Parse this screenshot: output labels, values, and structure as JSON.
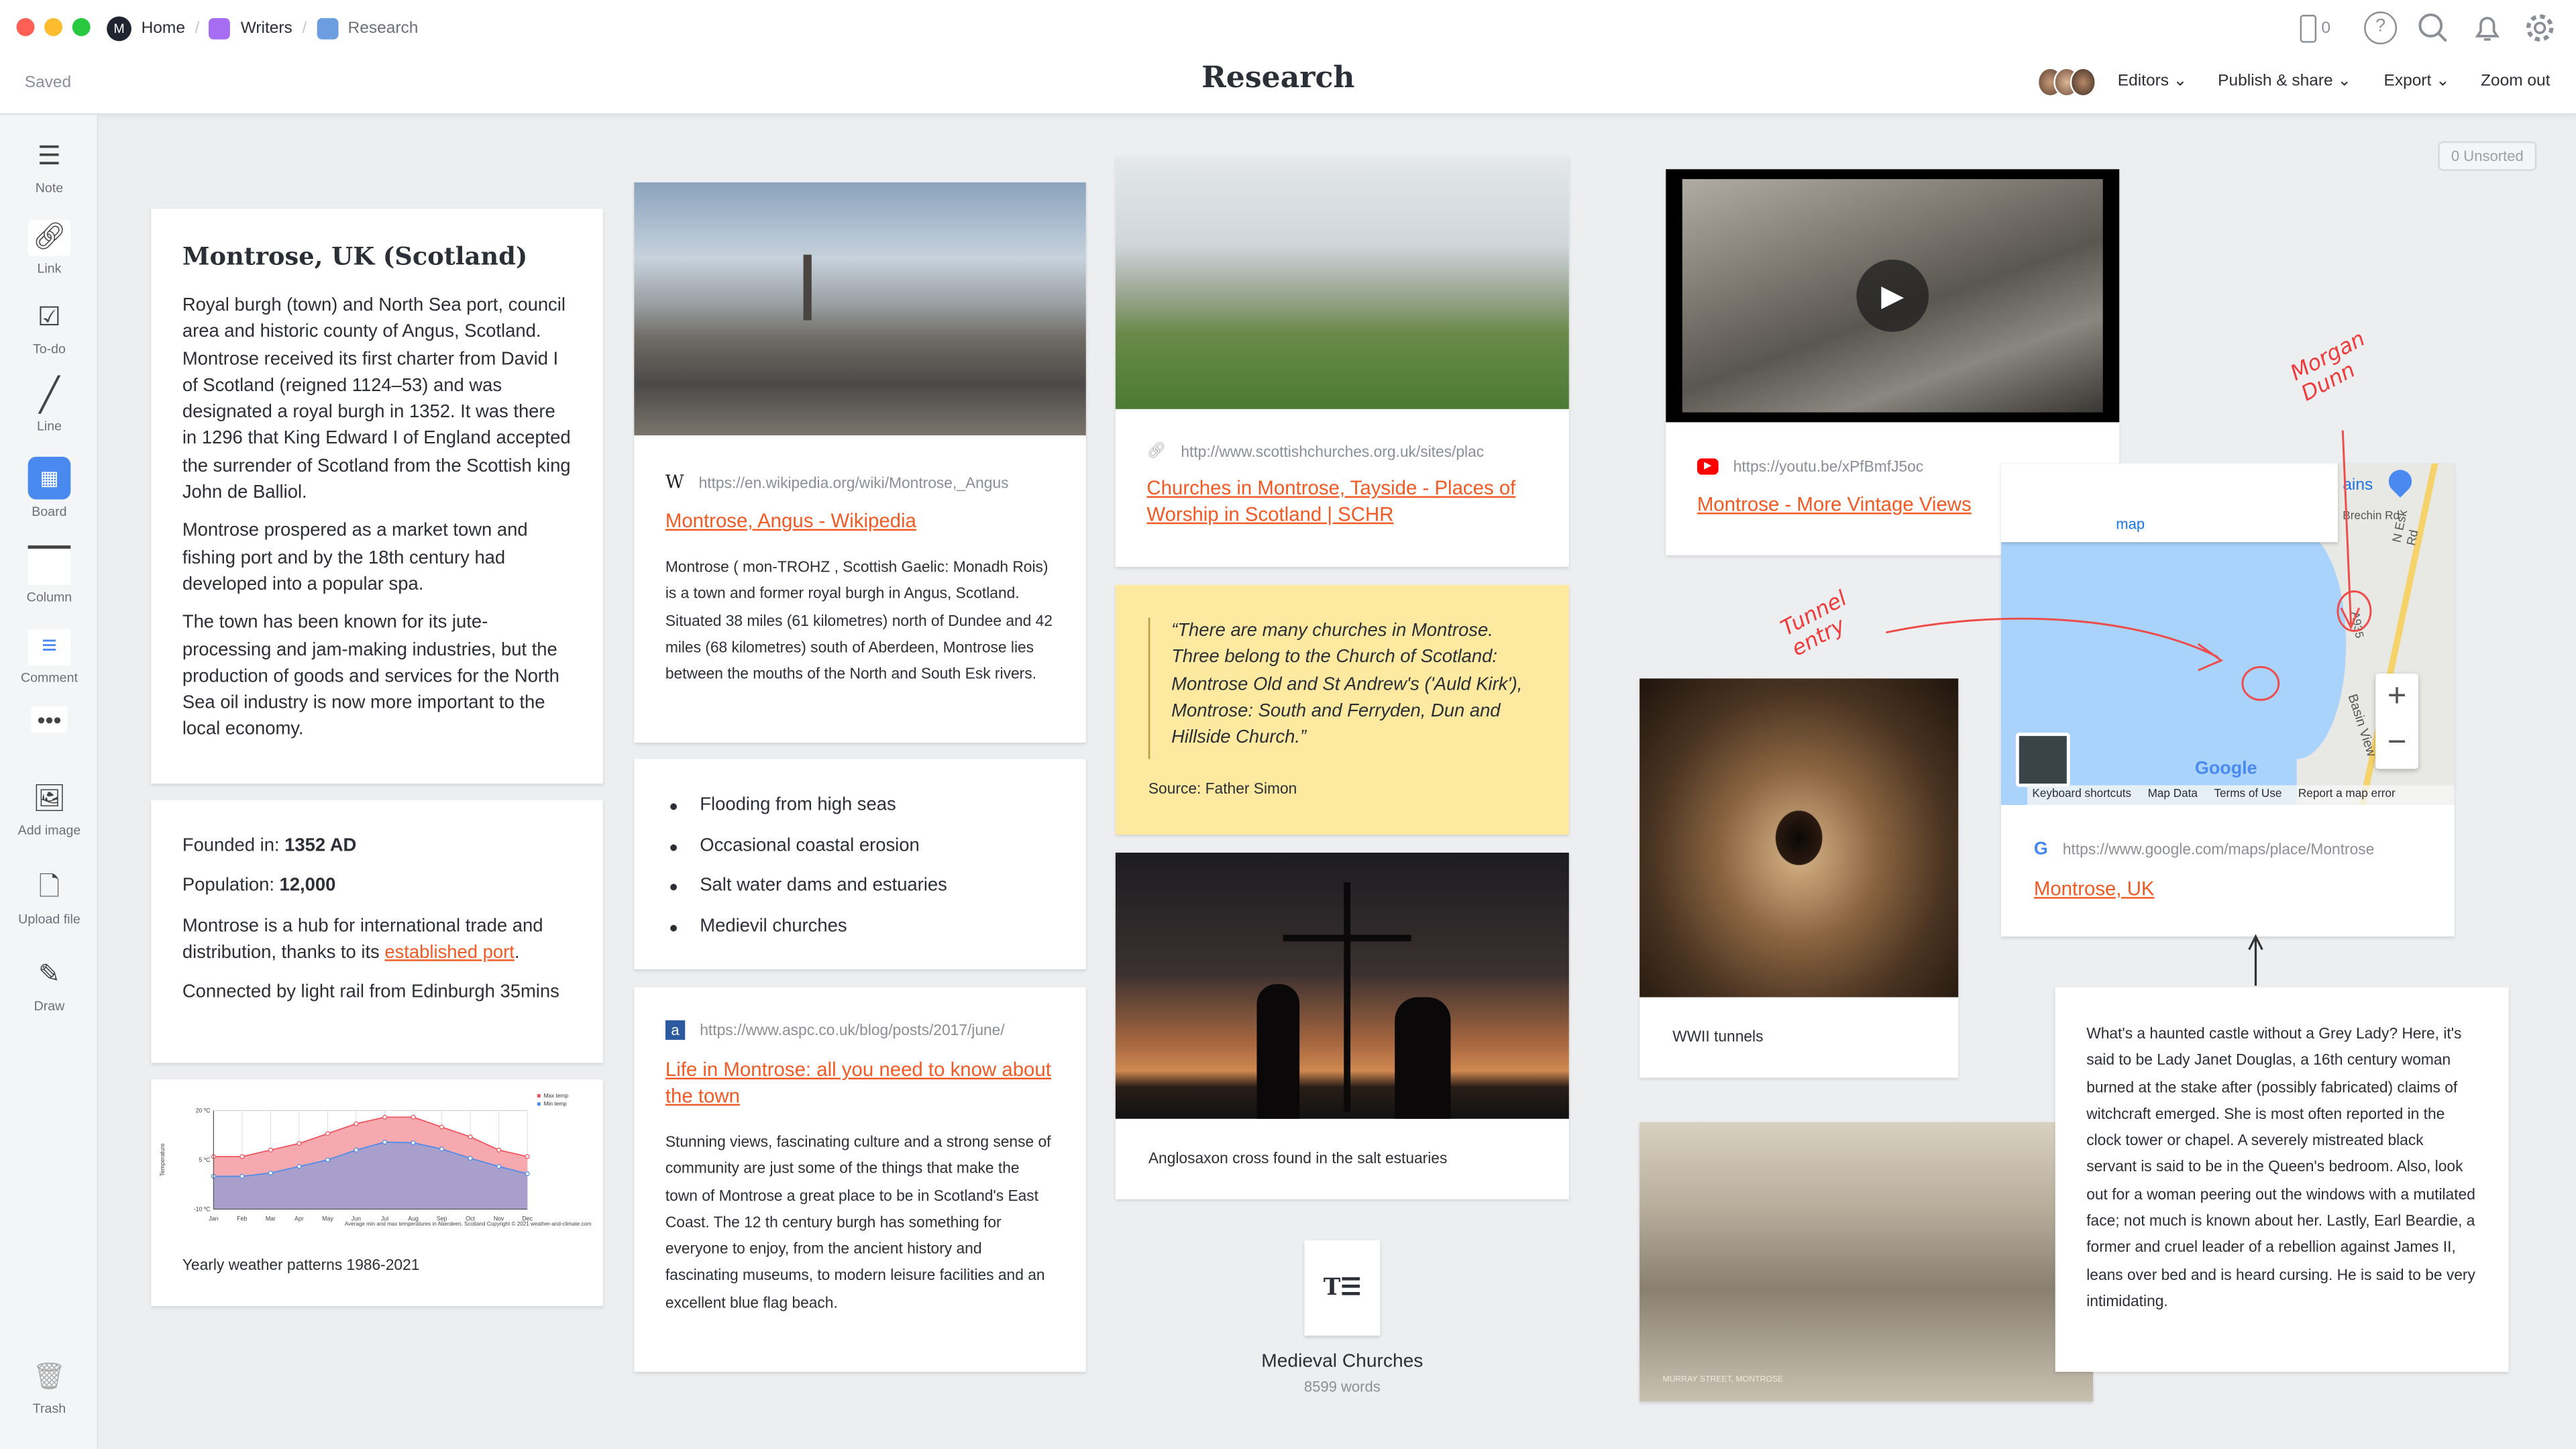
{
  "breadcrumb": [
    "Home",
    "Writers",
    "Research"
  ],
  "colors": {
    "accent": "#f15a24",
    "writers": "#a66cf2",
    "research": "#6b9de0",
    "quote_bg": "#fde9a0"
  },
  "header": {
    "saved": "Saved",
    "title": "Research",
    "device_count": "0",
    "editors": "Editors",
    "publish": "Publish & share",
    "export": "Export",
    "zoom_out": "Zoom out",
    "unsorted": "0 Unsorted"
  },
  "sidebar": [
    {
      "label": "Note",
      "icon": "note-icon"
    },
    {
      "label": "Link",
      "icon": "link-icon"
    },
    {
      "label": "To-do",
      "icon": "todo-icon"
    },
    {
      "label": "Line",
      "icon": "line-icon"
    },
    {
      "label": "Board",
      "icon": "board-icon"
    },
    {
      "label": "Column",
      "icon": "column-icon"
    },
    {
      "label": "Comment",
      "icon": "comment-icon"
    },
    {
      "label": "Add image",
      "icon": "image-icon"
    },
    {
      "label": "Upload file",
      "icon": "file-icon"
    },
    {
      "label": "Draw",
      "icon": "pencil-icon"
    },
    {
      "label": "Trash",
      "icon": "trash-icon"
    }
  ],
  "montrose": {
    "title": "Montrose, UK (Scotland)",
    "p1": "Royal burgh (town) and North Sea port, council area and historic county of Angus, Scotland. Montrose received its first charter from David I of Scotland (reigned 1124–53) and was designated a royal burgh in 1352. It was there in 1296 that King Edward I of England accepted the surrender of Scotland from the Scottish king John de Balliol.",
    "p2": "Montrose prospered as a market town and fishing port and by the 18th century had developed into a popular spa.",
    "p3": "The town has been known for its jute-processing and jam-making industries, but the production of goods and services for the North Sea oil industry is now more important to the local economy."
  },
  "facts": {
    "founded_label": "Founded in:",
    "founded": "1352 AD",
    "pop_label": "Population:",
    "pop": "12,000",
    "hub": "Montrose is a hub for international trade and distribution, thanks to its ",
    "hub_link": "established port",
    "hub_end": ".",
    "rail": "Connected by light rail from Edinburgh 35mins"
  },
  "chart_caption": "Yearly weather patterns 1986-2021",
  "chart_data": {
    "type": "area",
    "title": "",
    "caption": "Average min and max temperatures in Aberdeen, Scotland   Copyright © 2021  weather-and-climate.com",
    "ylabel": "Temperature",
    "ylim": [
      -10,
      20
    ],
    "yticks": [
      "20 ºC",
      "5 ºC",
      "-10 ºC"
    ],
    "ytick_values": [
      20,
      5,
      -10
    ],
    "categories": [
      "Jan",
      "Feb",
      "Mar",
      "Apr",
      "May",
      "Jun",
      "Jul",
      "Aug",
      "Sep",
      "Oct",
      "Nov",
      "Dec"
    ],
    "series": [
      {
        "name": "Max temp",
        "color": "#f0505a",
        "values": [
          6,
          6,
          8,
          10,
          13,
          16,
          18,
          18,
          15,
          12,
          8,
          6
        ]
      },
      {
        "name": "Min temp",
        "color": "#4a8ae8",
        "values": [
          0,
          0,
          1,
          3,
          5,
          8,
          10.4,
          10.2,
          8.3,
          5.5,
          3,
          0.8
        ]
      }
    ],
    "legend": "top-right",
    "grid": true
  },
  "wiki": {
    "url": "https://en.wikipedia.org/wiki/Montrose,_Angus",
    "title": "Montrose, Angus - Wikipedia",
    "text": "Montrose ( mon-TROHZ , Scottish Gaelic: Monadh Rois) is a town and former royal burgh in Angus, Scotland. Situated 38 miles (61 kilometres) north of Dundee and 42 miles (68 kilometres) south of Aberdeen, Montrose lies between the mouths of the North and South Esk rivers."
  },
  "list": [
    "Flooding from high seas",
    "Occasional coastal erosion",
    "Salt water dams and estuaries",
    "Medievil churches"
  ],
  "aspc": {
    "url": "https://www.aspc.co.uk/blog/posts/2017/june/",
    "title": "Life in Montrose: all you need to know about the town",
    "text": "Stunning views, fascinating culture and a strong sense of community are just some of the things that make the town of Montrose a great place to be in Scotland's East Coast. The 12 th century burgh has something for everyone to enjoy, from the ancient history and fascinating museums, to modern leisure facilities and an excellent blue flag beach."
  },
  "churches": {
    "url": "http://www.scottishchurches.org.uk/sites/plac",
    "title": "Churches in Montrose, Tayside - Places of Worship in Scotland | SCHR"
  },
  "quote": {
    "text": "“There are many churches in Montrose. Three belong to the Church of Scotland: Montrose Old and St Andrew's ('Auld Kirk'), Montrose: South and Ferryden, Dun and Hillside Church.”",
    "source": "Source: Father Simon"
  },
  "cross_caption": "Anglosaxon cross found in the salt estuaries",
  "doc": {
    "title": "Medieval Churches",
    "words": "8599 words"
  },
  "video": {
    "url": "https://youtu.be/xPfBmfJ5oc",
    "title": "Montrose - More Vintage Views"
  },
  "map": {
    "url": "https://www.google.com/maps/place/Montrose",
    "title": "Montrose, UK",
    "labels": [
      "map",
      "ains",
      "Brechin Rd",
      "N Esk Rd",
      "A935",
      "Basin View",
      "Google"
    ],
    "footer": [
      "Keyboard shortcuts",
      "Map Data",
      "Terms of Use",
      "Report a map error"
    ]
  },
  "tunnel_caption": "WWII tunnels",
  "ghost": "What's a haunted castle without a Grey Lady? Here, it's said to be Lady Janet Douglas, a 16th century woman burned at the stake after (possibly fabricated) claims of witchcraft emerged. She is most often reported in the clock tower or chapel. A severely mistreated black servant is said to be in the Queen's bedroom. Also, look out for a woman peering out the windows with a mutilated face; not much is known about her. Lastly, Earl Beardie, a former and cruel leader of a rebellion against James II, leans over bed and is heard cursing. He is said to be very intimidating.",
  "annotations": {
    "name": "Morgan Dunn",
    "tunnel": "Tunnel entry"
  },
  "street_caption": "MURRAY STREET, MONTROSE"
}
